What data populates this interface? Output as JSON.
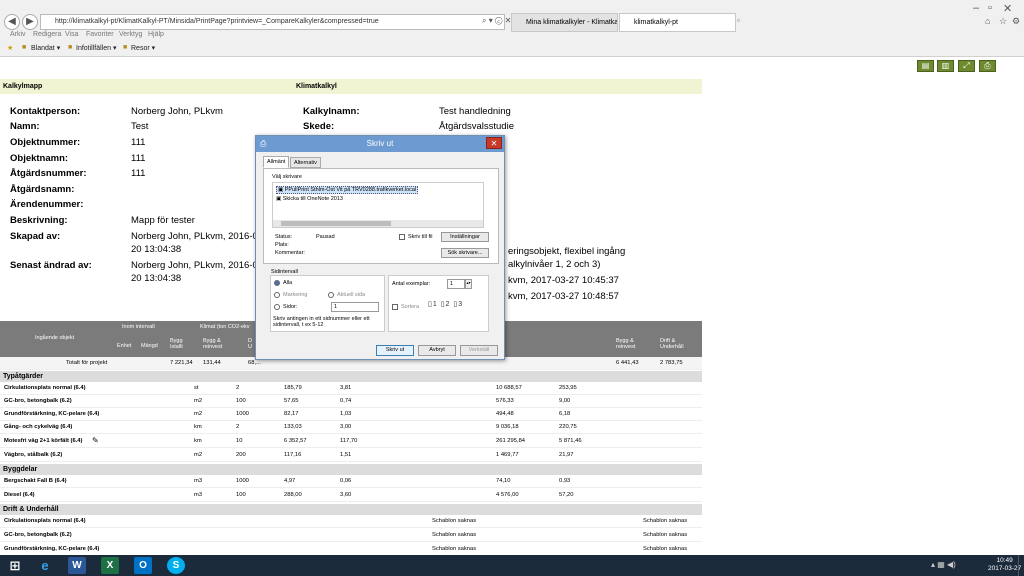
{
  "browser": {
    "url": "http://klimatkalkyl-pt/KlimatKalkyl-PT/Minsida/PrintPage?printview=_CompareKalkyler&compressed=true",
    "tabs": [
      {
        "label": "Mina klimatkalkyler - Klimatkal..."
      },
      {
        "label": "klimatkalkyl-pt"
      }
    ],
    "menu": [
      "Arkiv",
      "Redigera",
      "Visa",
      "Favoriter",
      "Verktyg",
      "Hjälp"
    ],
    "favorites": [
      "Blandat",
      "Infotillfällen",
      "Resor"
    ]
  },
  "page": {
    "bands": {
      "left": "Kalkylmapp",
      "right": "Klimatkalkyl"
    },
    "left_fields": [
      {
        "label": "Kontaktperson:",
        "value": "Norberg John, PLkvm"
      },
      {
        "label": "Namn:",
        "value": "Test"
      },
      {
        "label": "Objektnummer:",
        "value": "111"
      },
      {
        "label": "Objektnamn:",
        "value": "111"
      },
      {
        "label": "Åtgärdsnummer:",
        "value": "111"
      },
      {
        "label": "Åtgärdsnamn:",
        "value": ""
      },
      {
        "label": "Ärendenummer:",
        "value": ""
      },
      {
        "label": "Beskrivning:",
        "value": "Mapp för tester"
      },
      {
        "label": "Skapad av:",
        "value": "Norberg John, PLkvm, 2016-06",
        "value2": "20 13:04:38"
      },
      {
        "label": "Senast ändrad av:",
        "value": "Norberg John, PLkvm, 2016-06",
        "value2": "20 13:04:38"
      }
    ],
    "right_fields": [
      {
        "label": "Kalkylnamn:",
        "value": "Test handledning"
      },
      {
        "label": "Skede:",
        "value": "Åtgärdsvalsstudie"
      }
    ],
    "right_partial": [
      "eringsobjekt, flexibel ingång",
      "alkylnivåer 1, 2 och 3)",
      "kvm, 2017-03-27 10:45:37",
      "kvm, 2017-03-27 10:48:57"
    ],
    "grid_head": {
      "ingaende": "Ingående objekt",
      "inom_intervall": "Inom intervall",
      "klimat": "Klimat (ton CO2-ekv",
      "enhet": "Enhet",
      "mangd": "Mängd",
      "bygg_istallt": "Bygg\nIstallt",
      "bygg_reinvest": "Bygg &\nreinvest",
      "drift_trunc": "D\nU",
      "bygg_reinvest_r": "Bygg &\nreinvest",
      "drift_underhall": "Drift &\nUnderhåll"
    },
    "total_row": {
      "label": "Totalt för projekt",
      "v1": "7 221,34",
      "v2": "131,44",
      "v3": "68,...",
      "v4": "6 441,43",
      "v5": "2 783,75"
    },
    "sections": [
      {
        "title": "Typåtgärder",
        "rows": [
          {
            "name": "Cirkulationsplats normal (6.4)",
            "unit": "st",
            "qty": "2",
            "a": "185,79",
            "b": "3,81",
            "c": "10 688,57",
            "d": "253,95"
          },
          {
            "name": "GC-bro, betongbalk (6.2)",
            "unit": "m2",
            "qty": "100",
            "a": "57,65",
            "b": "0,74",
            "c": "576,33",
            "d": "9,00"
          },
          {
            "name": "Grundförstärkning, KC-pelare (6.4)",
            "unit": "m2",
            "qty": "1000",
            "a": "82,17",
            "b": "1,03",
            "c": "494,48",
            "d": "6,18"
          },
          {
            "name": "Gång- och cykelväg (6.4)",
            "unit": "km",
            "qty": "2",
            "a": "133,03",
            "b": "3,00",
            "c": "9 036,18",
            "d": "220,75"
          },
          {
            "name": "Motesfri väg 2+1 körfält (6.4)",
            "unit": "km",
            "qty": "10",
            "a": "6 352,57",
            "b": "117,70",
            "c": "261 295,84",
            "d": "5 871,46"
          },
          {
            "name": "Vägbro, stålbalk (6.2)",
            "unit": "m2",
            "qty": "200",
            "a": "117,16",
            "b": "1,51",
            "c": "1 469,77",
            "d": "21,97"
          }
        ]
      },
      {
        "title": "Byggdelar",
        "rows": [
          {
            "name": "Bergschakt Fall B (6.4)",
            "unit": "m3",
            "qty": "1000",
            "a": "4,97",
            "b": "0,06",
            "c": "74,10",
            "d": "0,93"
          },
          {
            "name": "Diesel (6.4)",
            "unit": "m3",
            "qty": "100",
            "a": "288,00",
            "b": "3,60",
            "c": "4 576,00",
            "d": "57,20"
          }
        ]
      },
      {
        "title": "Drift & Underhåll",
        "rows": [
          {
            "name": "Cirkulationsplats normal (6.4)",
            "note1": "Schablon saknas",
            "note2": "Schablon saknas"
          },
          {
            "name": "GC-bro, betongbalk (6.2)",
            "note1": "Schablon saknas",
            "note2": "Schablon saknas"
          },
          {
            "name": "Grundförstärkning, KC-pelare (6.4)",
            "note1": "Schablon saknas",
            "note2": "Schablon saknas"
          }
        ]
      }
    ]
  },
  "dialog": {
    "title": "Skriv ut",
    "tabs": [
      "Allmänt",
      "Alternativ"
    ],
    "group_printer": "Välj skrivare",
    "printers": [
      "PPullPrint Sthlm-Ost Vit på TRV0288.trafikverket.local",
      "Skicka till OneNote 2013"
    ],
    "status_label": "Status:",
    "status_value": "Pausad",
    "plats_label": "Plats:",
    "kommentar_label": "Kommentar:",
    "skriv_till_fil": "Skriv till fil",
    "installningar": "Inställningar",
    "sok_skrivare": "Sök skrivare...",
    "sidintervall": "Sidintervall",
    "alla": "Alla",
    "markering": "Markering",
    "aktuell_sida": "Aktuell sida",
    "sidor": "Sidor:",
    "sidor_value": "1",
    "help_text": "Skriv antingen in ett sidnummer eller ett sidintervall, t ex 5-12",
    "antal_label": "Antal exemplar:",
    "antal_value": "1",
    "sortera": "Sortera",
    "btn_print": "Skriv ut",
    "btn_cancel": "Avbryt",
    "btn_apply": "Verkställ"
  },
  "taskbar": {
    "time": "10:49",
    "date": "2017-03-27"
  }
}
